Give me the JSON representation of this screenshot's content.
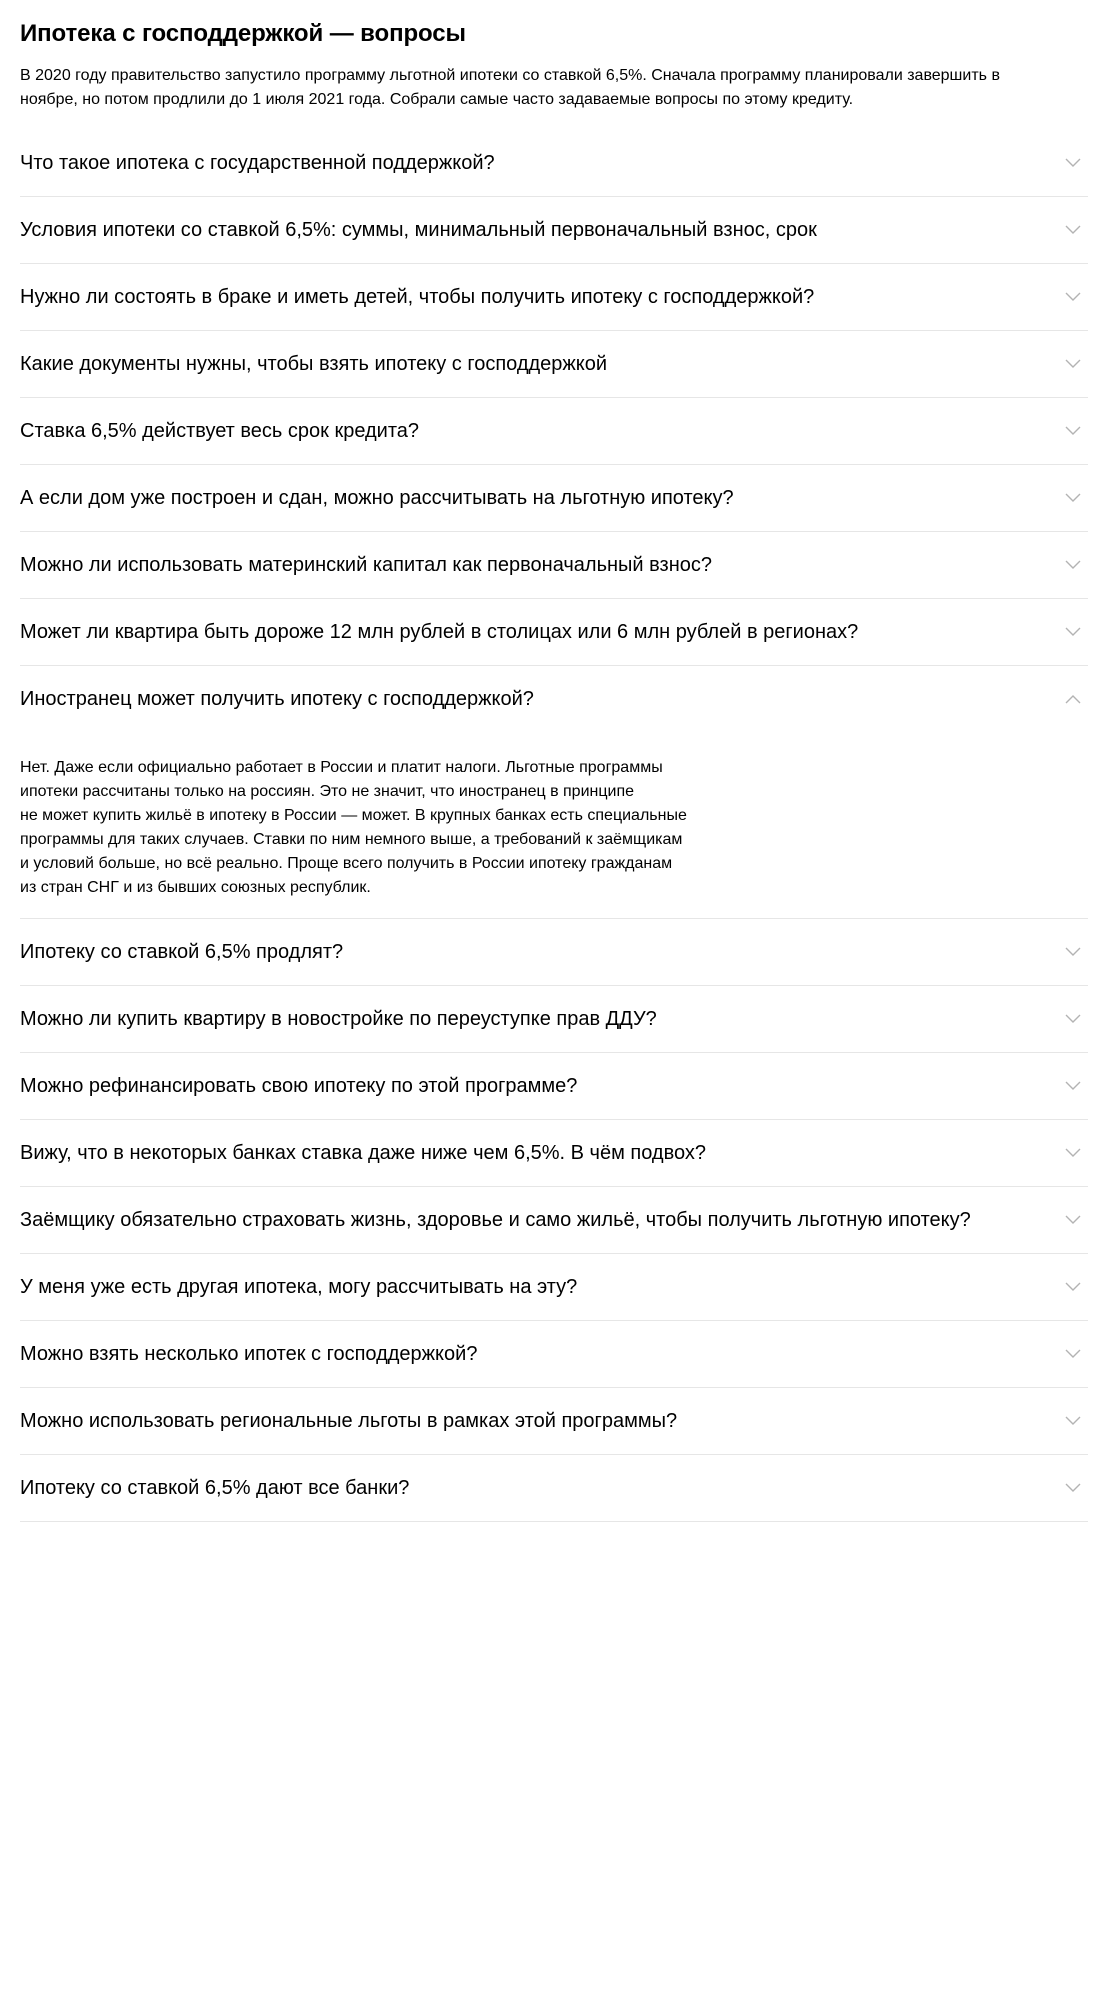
{
  "header": {
    "title": "Ипотека с господдержкой — вопросы",
    "intro": "В 2020 году правительство запустило программу льготной ипотеки со ставкой 6,5%. Сначала программу планировали завершить в ноябре, но потом продлили до 1 июля 2021 года. Собрали самые часто задаваемые вопросы по этому кредиту."
  },
  "colors": {
    "divider": "#e6e6e6",
    "chevron": "#b3b3b3",
    "text": "#000000"
  },
  "faq": {
    "items": [
      {
        "question": "Что такое ипотека с государственной поддержкой?",
        "expanded": false,
        "icon": "chevron-down-icon"
      },
      {
        "question": "Условия ипотеки со ставкой 6,5%: суммы, минимальный первоначальный взнос, срок",
        "expanded": false,
        "icon": "chevron-down-icon"
      },
      {
        "question": "Нужно ли состоять в браке и иметь детей, чтобы получить ипотеку с господдержкой?",
        "expanded": false,
        "icon": "chevron-down-icon"
      },
      {
        "question": "Какие документы нужны, чтобы взять ипотеку с господдержкой",
        "expanded": false,
        "icon": "chevron-down-icon"
      },
      {
        "question": "Ставка 6,5% действует весь срок кредита?",
        "expanded": false,
        "icon": "chevron-down-icon"
      },
      {
        "question": "А если дом уже построен и сдан, можно рассчитывать на льготную ипотеку?",
        "expanded": false,
        "icon": "chevron-down-icon"
      },
      {
        "question": "Можно ли использовать материнский капитал как первоначальный взнос?",
        "expanded": false,
        "icon": "chevron-down-icon"
      },
      {
        "question": "Может ли квартира быть дороже 12 млн рублей в столицах или 6 млн рублей в регионах?",
        "expanded": false,
        "icon": "chevron-down-icon"
      },
      {
        "question": "Иностранец может получить ипотеку с господдержкой?",
        "expanded": true,
        "icon": "chevron-up-icon",
        "answer_lines": [
          "Нет. Даже если официально работает в России и платит налоги. Льготные программы",
          "ипотеки рассчитаны только на россиян. Это не значит, что иностранец в принципе",
          "не может купить жильё в ипотеку в России — может. В крупных банках есть специальные",
          "программы для таких случаев. Ставки по ним немного выше, а требований к заёмщикам",
          "и условий больше, но всё реально. Проще всего получить в России ипотеку гражданам",
          "из стран СНГ и из бывших союзных республик."
        ]
      },
      {
        "question": "Ипотеку со ставкой 6,5% продлят?",
        "expanded": false,
        "icon": "chevron-down-icon"
      },
      {
        "question": "Можно ли купить квартиру в новостройке по переуступке прав ДДУ?",
        "expanded": false,
        "icon": "chevron-down-icon"
      },
      {
        "question": "Можно рефинансировать свою ипотеку по этой программе?",
        "expanded": false,
        "icon": "chevron-down-icon"
      },
      {
        "question": "Вижу, что в некоторых банках ставка даже ниже чем 6,5%. В чём подвох?",
        "expanded": false,
        "icon": "chevron-down-icon"
      },
      {
        "question": "Заёмщику обязательно страховать жизнь, здоровье и само жильё, чтобы получить льготную ипотеку?",
        "expanded": false,
        "icon": "chevron-down-icon"
      },
      {
        "question": "У меня уже есть другая ипотека, могу рассчитывать на эту?",
        "expanded": false,
        "icon": "chevron-down-icon"
      },
      {
        "question": "Можно взять несколько ипотек с господдержкой?",
        "expanded": false,
        "icon": "chevron-down-icon"
      },
      {
        "question": "Можно использовать региональные льготы в рамках этой программы?",
        "expanded": false,
        "icon": "chevron-down-icon"
      },
      {
        "question": "Ипотеку со ставкой 6,5% дают все банки?",
        "expanded": false,
        "icon": "chevron-down-icon"
      }
    ]
  }
}
